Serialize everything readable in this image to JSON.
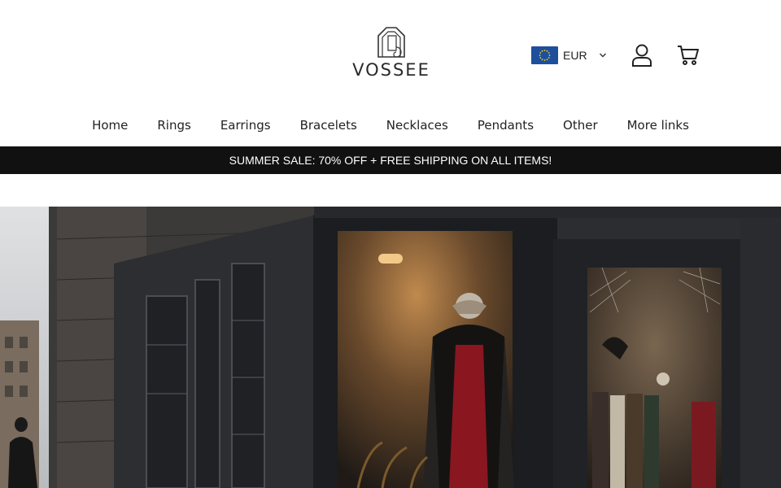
{
  "brand": {
    "name": "VOSSEE"
  },
  "header": {
    "currency": {
      "code": "EUR",
      "flag": "eu-flag-icon",
      "flag_color": "#1d4f9c"
    },
    "account_icon": "user-icon",
    "cart_icon": "cart-icon"
  },
  "nav": {
    "items": [
      {
        "label": "Home"
      },
      {
        "label": "Rings"
      },
      {
        "label": "Earrings"
      },
      {
        "label": "Bracelets"
      },
      {
        "label": "Necklaces"
      },
      {
        "label": "Pendants"
      },
      {
        "label": "Other"
      },
      {
        "label": "More links"
      }
    ]
  },
  "announcement": {
    "text": "SUMMER SALE: 70% OFF + FREE SHIPPING ON ALL ITEMS!",
    "background": "#111111"
  },
  "hero": {
    "image": "gothic-boutique-storefront",
    "accent_color": "#8a1620"
  }
}
